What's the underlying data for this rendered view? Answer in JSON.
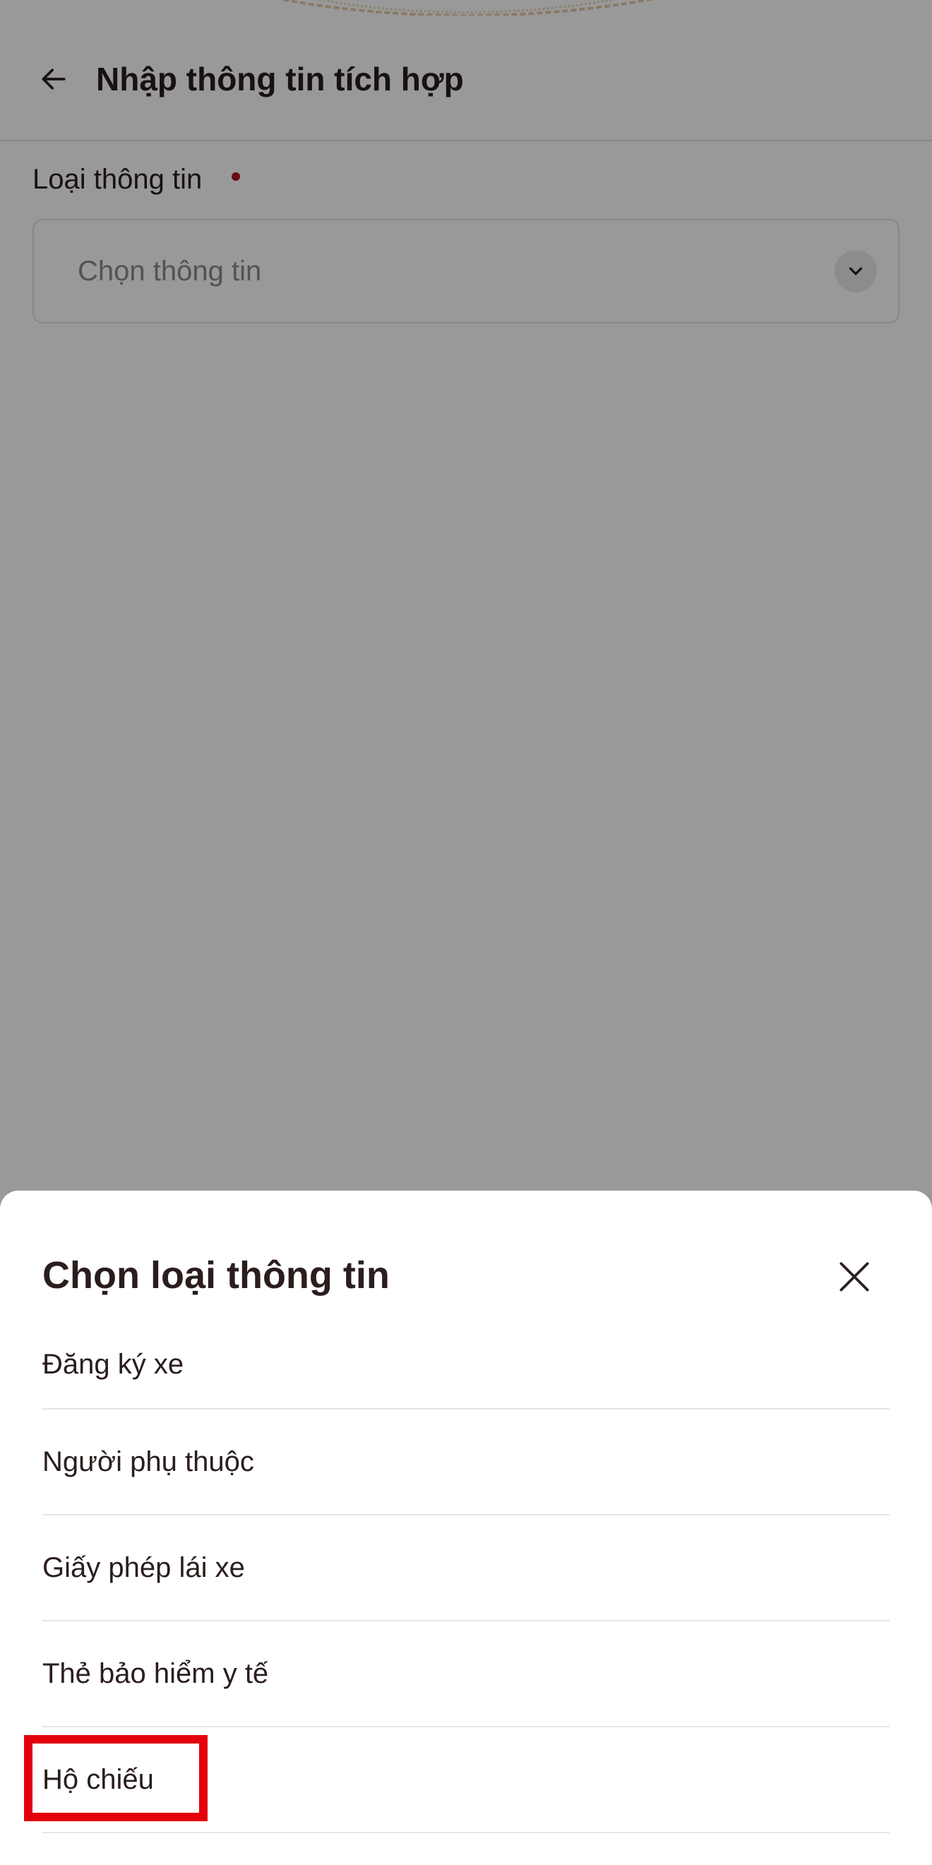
{
  "header": {
    "title": "Nhập thông tin tích hợp",
    "back_icon": "arrow-left-icon"
  },
  "form": {
    "field_label": "Loại thông tin",
    "required": true,
    "required_color": "#b3121b",
    "select_placeholder": "Chọn thông tin",
    "chevron_icon": "chevron-down-icon"
  },
  "sheet": {
    "title": "Chọn loại thông tin",
    "close_icon": "close-icon",
    "options": [
      {
        "label": "Đăng ký xe"
      },
      {
        "label": "Người phụ thuộc"
      },
      {
        "label": "Giấy phép lái xe"
      },
      {
        "label": "Thẻ bảo hiểm y tế"
      },
      {
        "label": "Hộ chiếu",
        "highlighted": true
      }
    ]
  },
  "colors": {
    "text_primary": "#2b1d1d",
    "highlight": "#e3000b",
    "placeholder": "#8a8a8a"
  }
}
